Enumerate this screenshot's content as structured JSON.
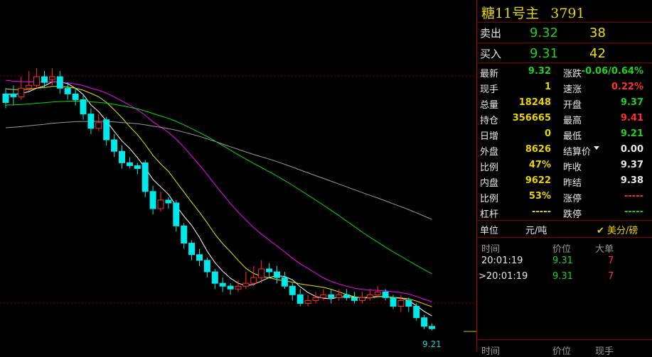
{
  "instrument": {
    "name": "糖11号主",
    "code": "3791"
  },
  "orderbook": {
    "sell": {
      "label": "卖出",
      "price": "9.32",
      "volume": "38"
    },
    "buy": {
      "label": "买入",
      "price": "9.31",
      "volume": "42"
    }
  },
  "quote_rows": [
    {
      "l1": "最新",
      "v1": "9.32",
      "c1": "green",
      "l2": "涨跌",
      "v2": "-0.06/0.64%",
      "c2": "green"
    },
    {
      "l1": "现手",
      "v1": "1",
      "c1": "yellow",
      "l2": "速涨",
      "v2": "0.22%",
      "c2": "red"
    },
    {
      "l1": "总量",
      "v1": "18248",
      "c1": "yellow",
      "l2": "开盘",
      "v2": "9.37",
      "c2": "green"
    },
    {
      "l1": "持仓",
      "v1": "356665",
      "c1": "yellow",
      "l2": "最高",
      "v2": "9.41",
      "c2": "red"
    },
    {
      "l1": "日增",
      "v1": "0",
      "c1": "yellow",
      "l2": "最低",
      "v2": "9.21",
      "c2": "green"
    },
    {
      "l1": "外盘",
      "v1": "8626",
      "c1": "yellow",
      "l2": "结算价",
      "v2": "0.00",
      "c2": "white",
      "dropdown": true
    },
    {
      "l1": "比例",
      "v1": "47%",
      "c1": "yellow",
      "l2": "昨收",
      "v2": "9.37",
      "c2": "white"
    },
    {
      "l1": "内盘",
      "v1": "9622",
      "c1": "yellow",
      "l2": "昨结",
      "v2": "9.38",
      "c2": "white"
    },
    {
      "l1": "比例",
      "v1": "53%",
      "c1": "yellow",
      "l2": "涨停",
      "v2": "-----",
      "c2": "dash"
    },
    {
      "l1": "杠杆",
      "v1": "-----",
      "c1": "yellow",
      "l2": "跌停",
      "v2": "-----",
      "c2": "dashg"
    }
  ],
  "unit": {
    "label": "单位",
    "value": "元/吨",
    "check_label": "美分/磅"
  },
  "ticks": {
    "headers": [
      "时间",
      "价位",
      "大单"
    ],
    "rows": [
      {
        "time": "20:01:19",
        "price": "9.31",
        "size": "7",
        "marker": ""
      },
      {
        "time": "20:01:19",
        "price": "9.31",
        "size": "7",
        "marker": ">"
      }
    ],
    "headers2": [
      "时间",
      "价位",
      "现手"
    ]
  },
  "chart_data": {
    "type": "candlestick",
    "last_price_label": "9.21",
    "ma_colors": {
      "ma5": "#ffffff",
      "ma10": "#e6e600",
      "ma20": "#ff00ff",
      "ma40": "#00dd00",
      "ma60": "#999999"
    },
    "candles": [
      [
        9.415,
        9.43,
        9.44,
        9.405,
        0
      ],
      [
        9.43,
        9.425,
        9.445,
        9.41,
        0
      ],
      [
        9.425,
        9.44,
        9.46,
        9.42,
        1
      ],
      [
        9.44,
        9.445,
        9.47,
        9.435,
        1
      ],
      [
        9.445,
        9.46,
        9.475,
        9.44,
        1
      ],
      [
        9.46,
        9.45,
        9.47,
        9.44,
        0
      ],
      [
        9.455,
        9.46,
        9.475,
        9.445,
        1
      ],
      [
        9.46,
        9.44,
        9.47,
        9.43,
        0
      ],
      [
        9.44,
        9.43,
        9.45,
        9.42,
        0
      ],
      [
        9.43,
        9.42,
        9.44,
        9.41,
        0
      ],
      [
        9.42,
        9.395,
        9.43,
        9.385,
        0
      ],
      [
        9.395,
        9.37,
        9.405,
        9.36,
        0
      ],
      [
        9.37,
        9.38,
        9.395,
        9.365,
        1
      ],
      [
        9.385,
        9.35,
        9.39,
        9.34,
        0
      ],
      [
        9.35,
        9.33,
        9.36,
        9.32,
        0
      ],
      [
        9.33,
        9.31,
        9.34,
        9.3,
        0
      ],
      [
        9.31,
        9.305,
        9.32,
        9.3,
        0
      ],
      [
        9.305,
        9.3,
        9.31,
        9.29,
        0
      ],
      [
        9.31,
        9.26,
        9.315,
        9.25,
        0
      ],
      [
        9.26,
        9.23,
        9.27,
        9.22,
        0
      ],
      [
        9.23,
        9.245,
        9.26,
        9.225,
        1
      ],
      [
        9.245,
        9.24,
        9.25,
        9.23,
        0
      ],
      [
        9.24,
        9.2,
        9.245,
        9.19,
        0
      ],
      [
        9.2,
        9.17,
        9.205,
        9.16,
        0
      ],
      [
        9.17,
        9.15,
        9.175,
        9.14,
        0
      ],
      [
        9.15,
        9.14,
        9.16,
        9.13,
        0
      ],
      [
        9.14,
        9.12,
        9.145,
        9.11,
        0
      ],
      [
        9.12,
        9.1,
        9.125,
        9.09,
        0
      ],
      [
        9.1,
        9.095,
        9.11,
        9.085,
        0
      ],
      [
        9.095,
        9.09,
        9.1,
        9.08,
        0
      ],
      [
        9.09,
        9.095,
        9.105,
        9.085,
        1
      ],
      [
        9.095,
        9.1,
        9.12,
        9.09,
        1
      ],
      [
        9.1,
        9.11,
        9.13,
        9.095,
        1
      ],
      [
        9.11,
        9.125,
        9.14,
        9.1,
        1
      ],
      [
        9.125,
        9.12,
        9.135,
        9.11,
        0
      ],
      [
        9.12,
        9.11,
        9.13,
        9.1,
        0
      ],
      [
        9.11,
        9.095,
        9.12,
        9.09,
        0
      ],
      [
        9.095,
        9.08,
        9.1,
        9.07,
        0
      ],
      [
        9.08,
        9.065,
        9.09,
        9.06,
        0
      ],
      [
        9.065,
        9.07,
        9.08,
        9.06,
        1
      ],
      [
        9.07,
        9.075,
        9.085,
        9.065,
        1
      ],
      [
        9.075,
        9.08,
        9.09,
        9.07,
        1
      ],
      [
        9.08,
        9.075,
        9.09,
        9.065,
        0
      ],
      [
        9.075,
        9.08,
        9.09,
        9.07,
        1
      ],
      [
        9.08,
        9.075,
        9.09,
        9.07,
        0
      ],
      [
        9.075,
        9.07,
        9.085,
        9.065,
        0
      ],
      [
        9.07,
        9.075,
        9.085,
        9.065,
        1
      ],
      [
        9.075,
        9.08,
        9.09,
        9.07,
        1
      ],
      [
        9.08,
        9.085,
        9.095,
        9.075,
        1
      ],
      [
        9.085,
        9.075,
        9.09,
        9.07,
        0
      ],
      [
        9.075,
        9.06,
        9.08,
        9.055,
        0
      ],
      [
        9.06,
        9.07,
        9.08,
        9.05,
        1
      ],
      [
        9.07,
        9.06,
        9.075,
        9.05,
        0
      ],
      [
        9.06,
        9.04,
        9.065,
        9.035,
        0
      ],
      [
        9.04,
        9.025,
        9.045,
        9.02,
        0
      ],
      [
        9.025,
        9.021,
        9.03,
        9.018,
        0
      ]
    ]
  }
}
